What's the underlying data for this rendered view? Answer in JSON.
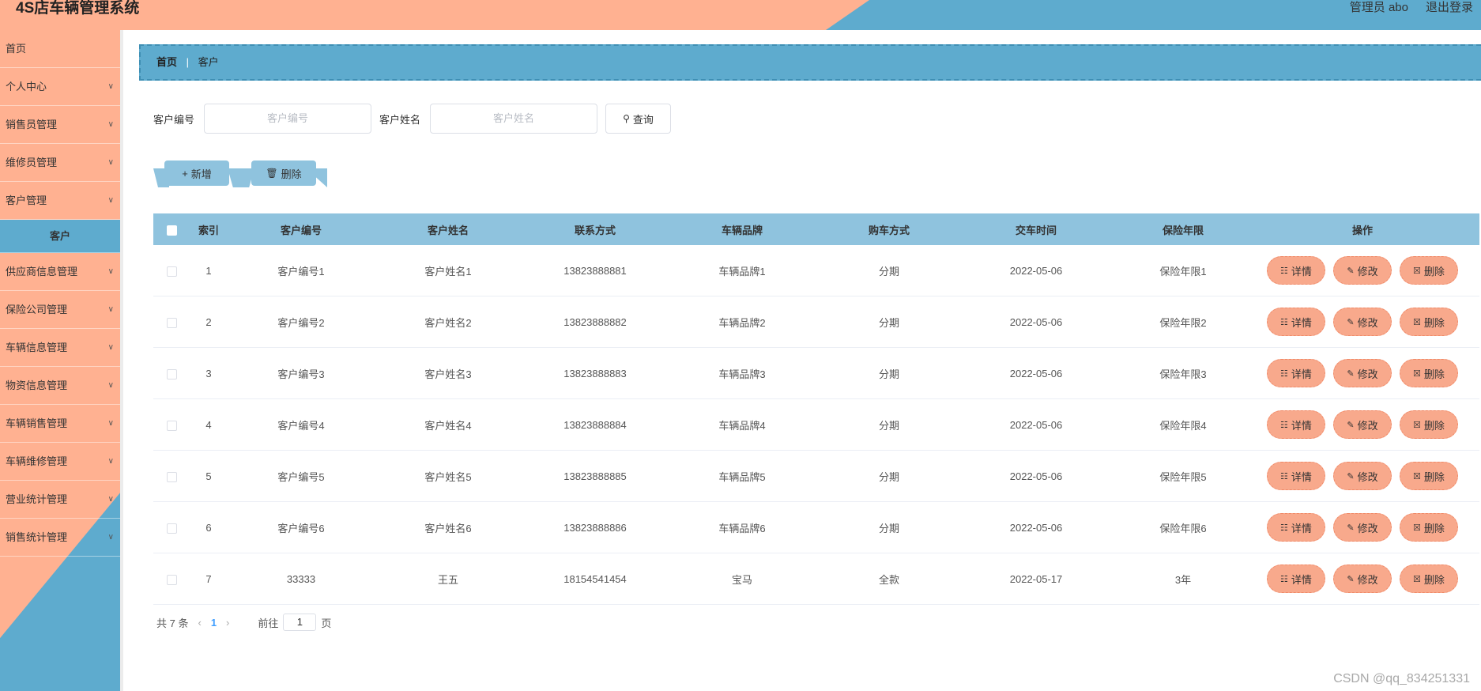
{
  "app": {
    "title": "4S店车辆管理系统",
    "admin": "管理员 abo",
    "logout": "退出登录"
  },
  "sidebar": {
    "items": [
      {
        "label": "首页",
        "chevron": false
      },
      {
        "label": "个人中心",
        "chevron": true
      },
      {
        "label": "销售员管理",
        "chevron": true
      },
      {
        "label": "维修员管理",
        "chevron": true
      },
      {
        "label": "客户管理",
        "chevron": true
      },
      {
        "label": "客户",
        "sub": true
      },
      {
        "label": "供应商信息管理",
        "chevron": true
      },
      {
        "label": "保险公司管理",
        "chevron": true
      },
      {
        "label": "车辆信息管理",
        "chevron": true
      },
      {
        "label": "物资信息管理",
        "chevron": true
      },
      {
        "label": "车辆销售管理",
        "chevron": true
      },
      {
        "label": "车辆维修管理",
        "chevron": true
      },
      {
        "label": "营业统计管理",
        "chevron": true
      },
      {
        "label": "销售统计管理",
        "chevron": true
      }
    ]
  },
  "breadcrumb": {
    "home": "首页",
    "separator": "|",
    "current": "客户"
  },
  "search": {
    "field1_label": "客户编号",
    "field1_placeholder": "客户编号",
    "field2_label": "客户姓名",
    "field2_placeholder": "客户姓名",
    "query_label": "查询"
  },
  "toolbar": {
    "add_label": "新增",
    "delete_label": "删除"
  },
  "table": {
    "headers": [
      "索引",
      "客户编号",
      "客户姓名",
      "联系方式",
      "车辆品牌",
      "购车方式",
      "交车时间",
      "保险年限",
      "操作"
    ],
    "rows": [
      [
        "1",
        "客户编号1",
        "客户姓名1",
        "13823888881",
        "车辆品牌1",
        "分期",
        "2022-05-06",
        "保险年限1"
      ],
      [
        "2",
        "客户编号2",
        "客户姓名2",
        "13823888882",
        "车辆品牌2",
        "分期",
        "2022-05-06",
        "保险年限2"
      ],
      [
        "3",
        "客户编号3",
        "客户姓名3",
        "13823888883",
        "车辆品牌3",
        "分期",
        "2022-05-06",
        "保险年限3"
      ],
      [
        "4",
        "客户编号4",
        "客户姓名4",
        "13823888884",
        "车辆品牌4",
        "分期",
        "2022-05-06",
        "保险年限4"
      ],
      [
        "5",
        "客户编号5",
        "客户姓名5",
        "13823888885",
        "车辆品牌5",
        "分期",
        "2022-05-06",
        "保险年限5"
      ],
      [
        "6",
        "客户编号6",
        "客户姓名6",
        "13823888886",
        "车辆品牌6",
        "分期",
        "2022-05-06",
        "保险年限6"
      ],
      [
        "7",
        "33333",
        "王五",
        "18154541454",
        "宝马",
        "全款",
        "2022-05-17",
        "3年"
      ]
    ],
    "row_actions": {
      "detail": "详情",
      "edit": "修改",
      "delete": "删除"
    }
  },
  "pagination": {
    "total": "共 7 条",
    "current_page": "1",
    "goto_prefix": "前往",
    "goto_value": "1",
    "goto_suffix": "页"
  },
  "watermark": "CSDN @qq_834251331",
  "colors": {
    "salmon": "#ffb191",
    "blue": "#5eabce",
    "table_header": "#8fc3de",
    "op_button": "#f8a98c"
  },
  "icons": {
    "chevron": "chevron-down-icon",
    "search": "search-icon",
    "add": "plus-icon",
    "delete": "trash-icon",
    "detail": "document-icon",
    "edit": "pencil-icon"
  }
}
